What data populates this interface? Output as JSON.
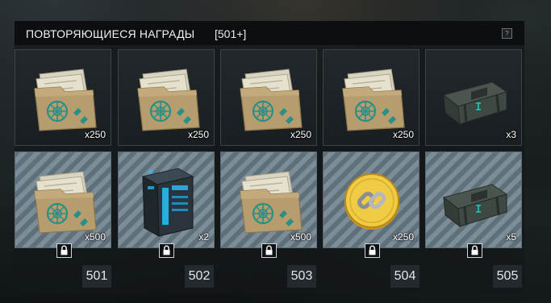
{
  "header": {
    "title": "ПОВТОРЯЮЩИЕСЯ НАГРАДЫ",
    "count": "[501+]",
    "help": "?"
  },
  "colors": {
    "accent": "#29c3c4",
    "locked_stripe_light": "#7c8d98",
    "locked_stripe_dark": "#5f707b",
    "coin_gold": "#e2b72e"
  },
  "rows": [
    {
      "cards": [
        {
          "icon": "blueprint-folder-icon",
          "qty": "x250",
          "locked": false
        },
        {
          "icon": "blueprint-folder-icon",
          "qty": "x250",
          "locked": false
        },
        {
          "icon": "blueprint-folder-icon",
          "qty": "x250",
          "locked": false
        },
        {
          "icon": "blueprint-folder-icon",
          "qty": "x250",
          "locked": false
        },
        {
          "icon": "ammo-crate-icon",
          "qty": "x3",
          "locked": false
        }
      ]
    },
    {
      "cards": [
        {
          "icon": "blueprint-folder-icon",
          "qty": "x500",
          "locked": true,
          "level": "501"
        },
        {
          "icon": "tech-battery-box-icon",
          "qty": "x2",
          "locked": true,
          "level": "502"
        },
        {
          "icon": "blueprint-folder-icon",
          "qty": "x500",
          "locked": true,
          "level": "503"
        },
        {
          "icon": "gold-link-coin-icon",
          "qty": "x250",
          "locked": true,
          "level": "504"
        },
        {
          "icon": "ammo-crate-icon",
          "qty": "x5",
          "locked": true,
          "level": "505"
        }
      ]
    }
  ]
}
